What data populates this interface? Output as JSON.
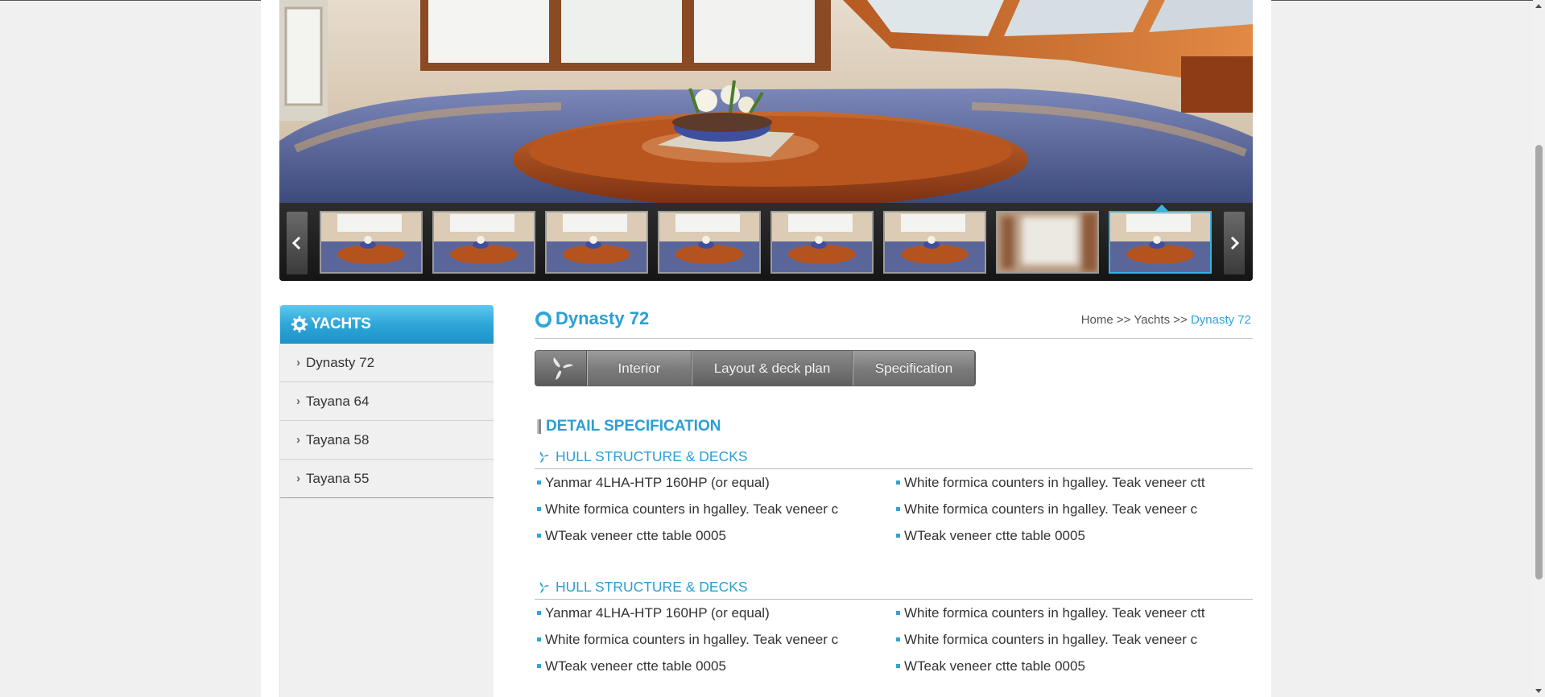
{
  "hero": {
    "slides": [
      {
        "kind": "salon"
      },
      {
        "kind": "salon"
      },
      {
        "kind": "salon"
      },
      {
        "kind": "salon"
      },
      {
        "kind": "salon"
      },
      {
        "kind": "salon"
      },
      {
        "kind": "blurred"
      },
      {
        "kind": "salon"
      }
    ],
    "active_index": 7,
    "prev_icon": "chevron-left-icon",
    "next_icon": "chevron-right-icon"
  },
  "sidebar": {
    "title": "YACHTS",
    "icon": "gear-icon",
    "items": [
      {
        "label": "Dynasty 72"
      },
      {
        "label": "Tayana 64"
      },
      {
        "label": "Tayana 58"
      },
      {
        "label": "Tayana 55"
      }
    ]
  },
  "main": {
    "title": "Dynasty 72",
    "breadcrumb": {
      "home": "Home",
      "sep1": ">>",
      "yachts": "Yachts",
      "sep2": ">>",
      "current": "Dynasty 72"
    },
    "tabs": [
      {
        "label": "Interior"
      },
      {
        "label": "Layout & deck plan"
      },
      {
        "label": "Specification"
      }
    ],
    "detail_title": "DETAIL SPECIFICATION",
    "sections": [
      {
        "heading": "HULL STRUCTURE & DECKS",
        "items": [
          "Yanmar 4LHA-HTP 160HP (or equal)",
          "White formica counters in hgalley. Teak veneer ctt",
          "White formica counters in hgalley. Teak veneer c",
          "White formica counters in hgalley. Teak veneer c",
          "WTeak veneer ctte table 0005",
          "WTeak veneer ctte table 0005"
        ]
      },
      {
        "heading": "HULL STRUCTURE & DECKS",
        "items": [
          "Yanmar 4LHA-HTP 160HP (or equal)",
          "White formica counters in hgalley. Teak veneer ctt",
          "White formica counters in hgalley. Teak veneer c",
          "White formica counters in hgalley. Teak veneer c",
          "WTeak veneer ctte table 0005",
          "WTeak veneer ctte table 0005"
        ]
      }
    ]
  },
  "colors": {
    "accent": "#2ea6d9",
    "tab_bg": "#7c7c7c",
    "sidebar_bg": "#f0f0f0"
  }
}
